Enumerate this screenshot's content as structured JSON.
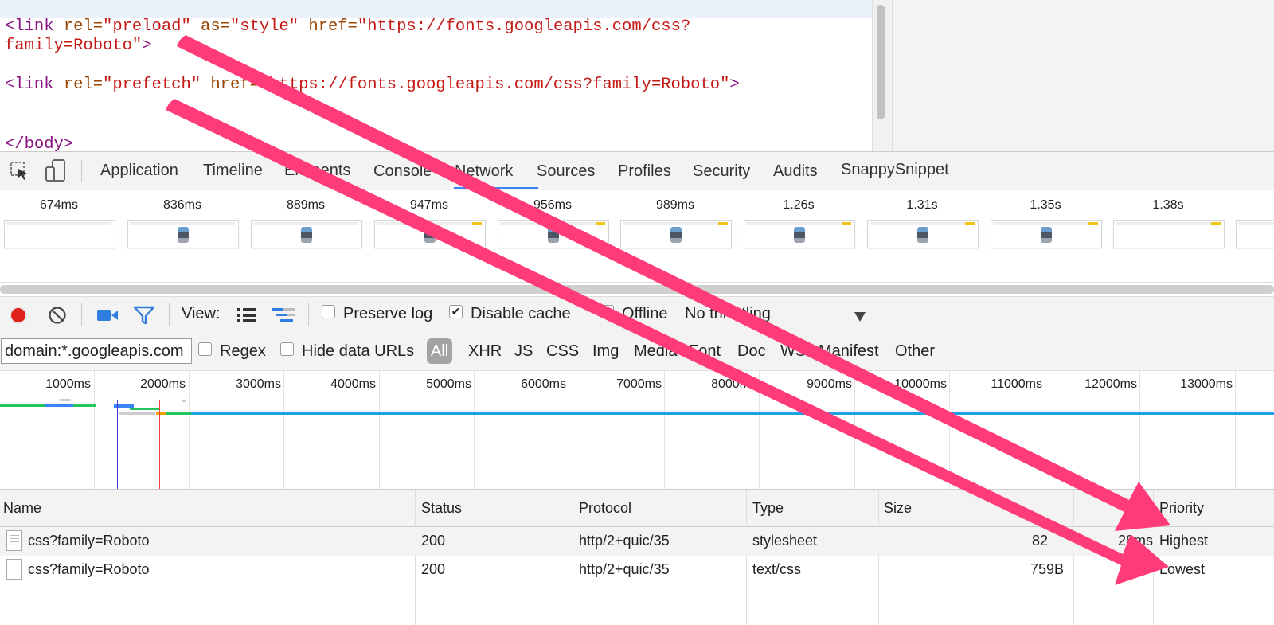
{
  "source": {
    "line1_tag_open": "<link",
    "line1_attr1": " rel=",
    "line1_val1": "\"preload\"",
    "line1_attr2": " as=",
    "line1_val2": "\"style\"",
    "line1_attr3": " href=",
    "line1_val3": "\"https://fonts.googleapis.com/css?",
    "line1b_val": "family=Roboto\"",
    "line1b_close": ">",
    "line2_tag_open": "<link",
    "line2_attr1": " rel=",
    "line2_val1": "\"prefetch\"",
    "line2_attr2": " href=",
    "line2_val2": "\"https://fonts.googleapis.com/css?family=Roboto\"",
    "line2_close": ">",
    "line3": "</body>"
  },
  "tabs": [
    "Application",
    "Timeline",
    "Elements",
    "Console",
    "Network",
    "Sources",
    "Profiles",
    "Security",
    "Audits",
    "SnappySnippet"
  ],
  "active_tab": "Network",
  "filmstrip": [
    "674ms",
    "836ms",
    "889ms",
    "947ms",
    "956ms",
    "989ms",
    "1.26s",
    "1.31s",
    "1.35s",
    "1.38s"
  ],
  "toolbar": {
    "view_label": "View:",
    "preserve_log": "Preserve log",
    "preserve_log_checked": false,
    "disable_cache": "Disable cache",
    "disable_cache_checked": true,
    "offline": "Offline",
    "offline_checked": false,
    "throttling": "No throttling"
  },
  "filterbar": {
    "filter_value": "domain:*.googleapis.com",
    "regex": "Regex",
    "hide_data_urls": "Hide data URLs",
    "all": "All",
    "types": [
      "XHR",
      "JS",
      "CSS",
      "Img",
      "Media",
      "Font",
      "Doc",
      "WS",
      "Manifest",
      "Other"
    ]
  },
  "overview_ticks": [
    "1000ms",
    "2000ms",
    "3000ms",
    "4000ms",
    "5000ms",
    "6000ms",
    "7000ms",
    "8000ms",
    "9000ms",
    "10000ms",
    "11000ms",
    "12000ms",
    "13000ms"
  ],
  "table": {
    "headers": {
      "name": "Name",
      "status": "Status",
      "protocol": "Protocol",
      "type": "Type",
      "size": "Size",
      "time": "",
      "priority": "Priority"
    },
    "rows": [
      {
        "name": "css?family=Roboto",
        "status": "200",
        "protocol": "http/2+quic/35",
        "type": "stylesheet",
        "size": "82",
        "time": "28ms",
        "priority": "Highest"
      },
      {
        "name": "css?family=Roboto",
        "status": "200",
        "protocol": "http/2+quic/35",
        "type": "text/css",
        "size": "759B",
        "time": "s",
        "priority": "Lowest"
      }
    ]
  },
  "colors": {
    "arrow": "#ff3b78",
    "accent": "#3b82f6",
    "record": "#e0201b"
  }
}
